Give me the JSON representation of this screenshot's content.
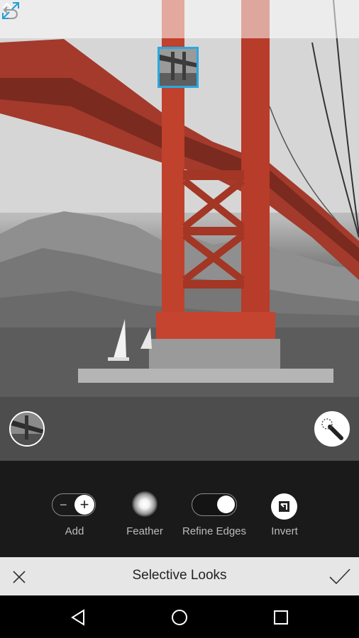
{
  "panel": {
    "title": "Selective Looks"
  },
  "tools": {
    "add_label": "Add",
    "add_minus": "−",
    "add_plus": "+",
    "feather_label": "Feather",
    "refine_label": "Refine Edges",
    "refine_on": true,
    "invert_label": "Invert"
  },
  "icons": {
    "undo": "undo-icon",
    "fullscreen": "fullscreen-icon",
    "brush": "magic-brush-icon",
    "expand": "chevron-up-icon",
    "close": "close-icon",
    "confirm": "checkmark-icon",
    "back": "back-icon",
    "home": "home-icon",
    "recents": "recents-icon"
  },
  "colors": {
    "accent": "#29a8e0",
    "bridge": "#c0412c",
    "panel_bg": "#1a1a1a",
    "title_bar_bg": "#e6e6e6"
  }
}
